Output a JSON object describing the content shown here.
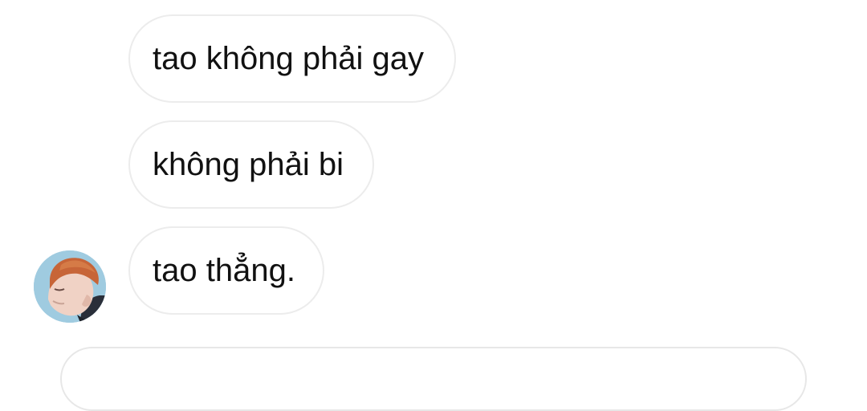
{
  "messages": [
    {
      "text": "tao không phải gay"
    },
    {
      "text": "không phải bi"
    },
    {
      "text": "tao thẳng."
    }
  ],
  "avatar": {
    "icon": "user-avatar"
  },
  "colors": {
    "bubble_border": "#ececec",
    "text": "#111111",
    "background": "#ffffff"
  }
}
